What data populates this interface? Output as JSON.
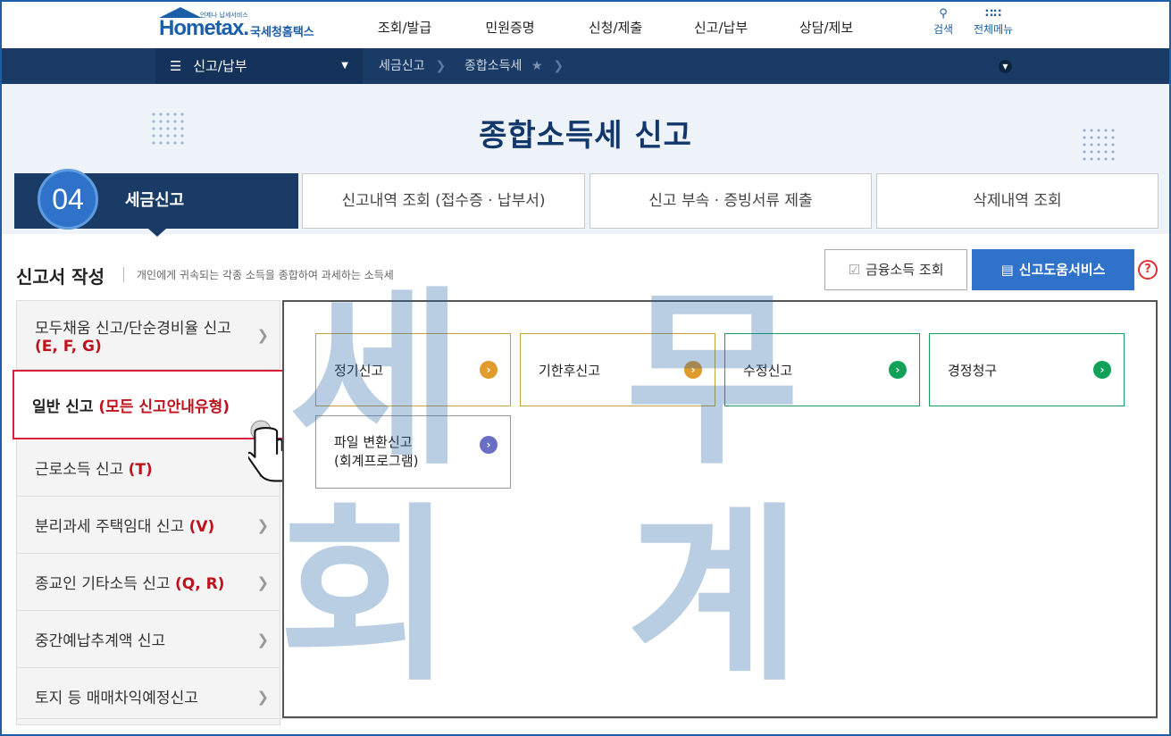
{
  "header": {
    "logo_brand": "Hometax.",
    "logo_small": "언제나 납세서비스",
    "logo_kr": "국세청홈택스",
    "gnb": [
      "조회/발급",
      "민원증명",
      "신청/제출",
      "신고/납부",
      "상담/제보"
    ],
    "search_label": "검색",
    "all_menu_label": "전체메뉴"
  },
  "navbar": {
    "menu_label": "신고/납부",
    "crumbs": [
      "세금신고",
      "종합소득세"
    ]
  },
  "hero": {
    "title": "종합소득세 신고"
  },
  "steps": {
    "active_number": "04",
    "active_label": "세금신고",
    "tabs": [
      "신고내역 조회 (접수증 · 납부서)",
      "신고 부속 · 증빙서류 제출",
      "삭제내역 조회"
    ]
  },
  "section": {
    "title": "신고서 작성",
    "desc": "개인에게 귀속되는 각종 소득을 종합하여 과세하는 소득세",
    "finance_btn": "금융소득 조회",
    "help_btn": "신고도움서비스"
  },
  "side_menu": [
    {
      "label": "모두채움 신고/단순경비율 신고",
      "code": "(E, F, G)"
    },
    {
      "label": "일반 신고",
      "code": "(모든 신고안내유형)"
    },
    {
      "label": "근로소득 신고",
      "code": "(T)"
    },
    {
      "label": "분리과세 주택임대 신고",
      "code": "(V)"
    },
    {
      "label": "종교인 기타소득 신고",
      "code": "(Q, R)"
    },
    {
      "label": "중간예납추계액 신고",
      "code": ""
    },
    {
      "label": "토지 등 매매차익예정신고",
      "code": ""
    }
  ],
  "filing_types": {
    "regular": "정기신고",
    "late": "기한후신고",
    "amended": "수정신고",
    "correction": "경정청구",
    "file_conv_1": "파일 변환신고",
    "file_conv_2": "(회계프로그램)"
  },
  "watermark": [
    "세",
    "무",
    "회",
    "계"
  ],
  "colors": {
    "brand_blue": "#1b5fa8",
    "navbar_navy": "#1a3b66",
    "accent_red": "#c0121d",
    "gold": "#e09b2d",
    "green": "#12a159",
    "violet": "#6a6fc4"
  }
}
